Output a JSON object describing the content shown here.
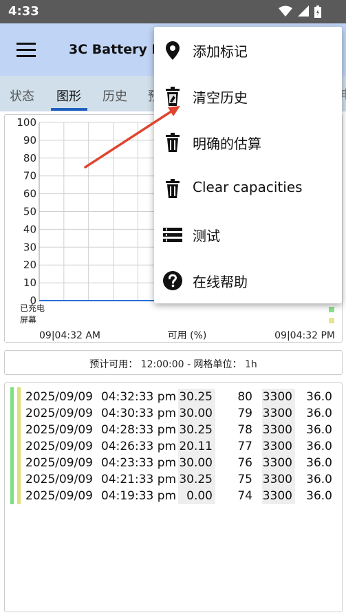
{
  "status_bar": {
    "time": "4:33",
    "icons": [
      "wifi-icon",
      "cellular-signal-icon",
      "battery-charging-icon"
    ]
  },
  "app_bar": {
    "title": "3C Battery Ma",
    "menu_icon": "hamburger-menu-icon",
    "color": "#c0d4f5"
  },
  "tabs": [
    {
      "label": "状态",
      "active": false
    },
    {
      "label": "图形",
      "active": true
    },
    {
      "label": "历史",
      "active": false
    },
    {
      "label": "预",
      "active": false
    }
  ],
  "tab_edge_char": "电",
  "chart_data": {
    "type": "line",
    "y_ticks": [
      "100",
      "90",
      "80",
      "70",
      "60",
      "50",
      "40",
      "30",
      "20",
      "10",
      "0"
    ],
    "ylim": [
      0,
      100
    ],
    "x_start_label": "09|04:32 AM",
    "x_end_label": "09|04:32 PM",
    "xlabel": "可用 (%)",
    "legend_charged": "已充电",
    "legend_screen": "屏幕",
    "grid": true,
    "series": [
      {
        "values": [
          0,
          0
        ],
        "color": "#2a6fd6"
      }
    ]
  },
  "forecast": {
    "text": "预计可用： 12:00:00 - 网格单位： 1h"
  },
  "history": {
    "rows": [
      {
        "date": "2025/09/09",
        "time": "04:32:33 pm",
        "current": "30.25",
        "percent": "80",
        "capacity": "3300",
        "temp": "36.0"
      },
      {
        "date": "2025/09/09",
        "time": "04:30:33 pm",
        "current": "30.00",
        "percent": "79",
        "capacity": "3300",
        "temp": "36.0"
      },
      {
        "date": "2025/09/09",
        "time": "04:28:33 pm",
        "current": "30.25",
        "percent": "78",
        "capacity": "3300",
        "temp": "36.0"
      },
      {
        "date": "2025/09/09",
        "time": "04:26:33 pm",
        "current": "20.11",
        "percent": "77",
        "capacity": "3300",
        "temp": "36.0"
      },
      {
        "date": "2025/09/09",
        "time": "04:23:33 pm",
        "current": "30.00",
        "percent": "76",
        "capacity": "3300",
        "temp": "36.0"
      },
      {
        "date": "2025/09/09",
        "time": "04:21:33 pm",
        "current": "30.25",
        "percent": "75",
        "capacity": "3300",
        "temp": "36.0"
      },
      {
        "date": "2025/09/09",
        "time": "04:19:33 pm",
        "current": "0.00",
        "percent": "74",
        "capacity": "3300",
        "temp": "36.0"
      }
    ]
  },
  "menu": {
    "items": [
      {
        "label": "添加标记",
        "icon": "location-pin-icon"
      },
      {
        "label": "清空历史",
        "icon": "clear-history-trash-icon"
      },
      {
        "label": "明确的估算",
        "icon": "trash-icon"
      },
      {
        "label": "Clear capacities",
        "icon": "trash-icon"
      },
      {
        "label": "测试",
        "icon": "list-icon"
      },
      {
        "label": "在线帮助",
        "icon": "help-icon"
      }
    ]
  },
  "annotation": {
    "arrow_color": "#e0442e"
  }
}
